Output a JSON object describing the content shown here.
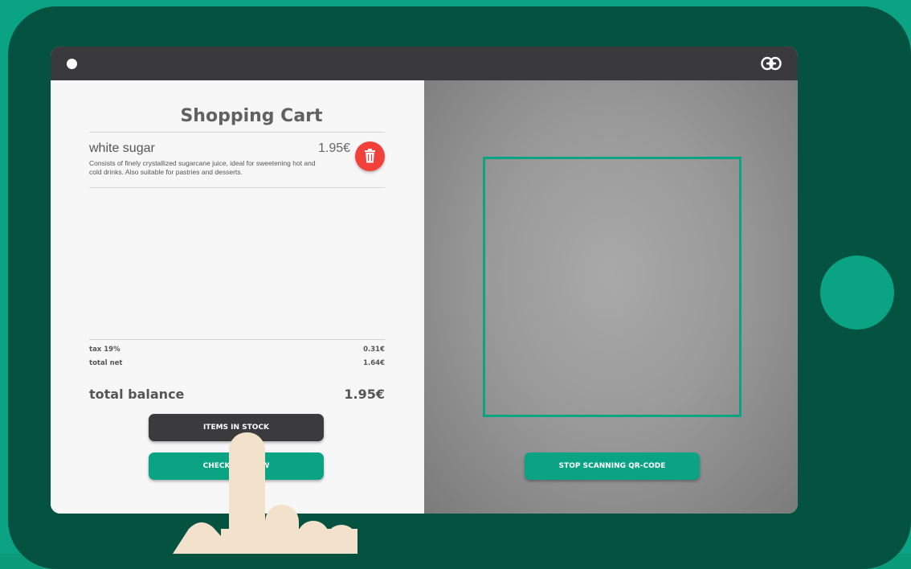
{
  "cart": {
    "title": "Shopping Cart",
    "items": [
      {
        "name": "white sugar",
        "description": "Consists of finely crystallized sugarcane juice, ideal for sweetening hot and cold drinks. Also suitable for pastries and desserts.",
        "price": "1.95€"
      }
    ],
    "tax_label": "tax 19%",
    "tax_value": "0.31€",
    "net_label": "total net",
    "net_value": "1.64€",
    "balance_label": "total balance",
    "balance_value": "1.95€",
    "items_in_stock_label": "ITEMS IN STOCK",
    "checkout_label": "CHECKOUT NOW"
  },
  "scanner": {
    "stop_label": "STOP SCANNING QR-CODE"
  },
  "icons": {
    "status": "status-dot-icon",
    "link": "link-icon",
    "delete": "trash-icon",
    "pointer": "hand-pointer-icon"
  },
  "colors": {
    "accent": "#0aa383",
    "tablet_body": "#045240",
    "topbar": "#3a3a3d",
    "delete": "#f2413a"
  }
}
